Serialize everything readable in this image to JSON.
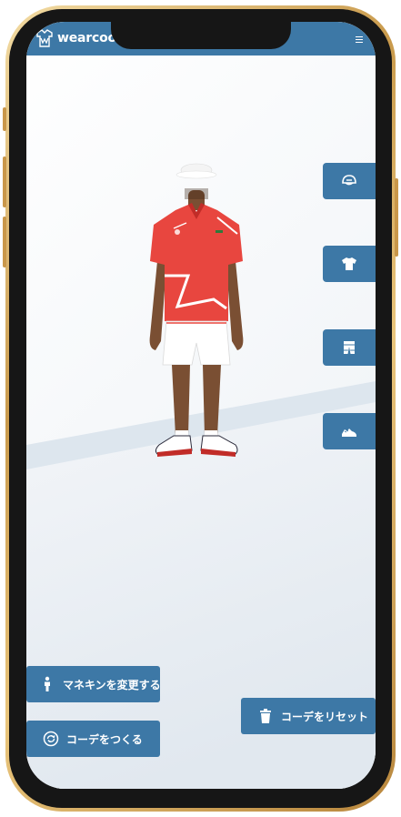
{
  "app": {
    "logo_text": "wearcoord"
  },
  "side_tabs": [
    {
      "id": "head",
      "icon": "cap-icon"
    },
    {
      "id": "tops",
      "icon": "tshirt-icon"
    },
    {
      "id": "bottoms",
      "icon": "shorts-icon"
    },
    {
      "id": "shoes",
      "icon": "sneakers-icon"
    }
  ],
  "buttons": {
    "change_mannequin": "マネキンを変更する",
    "make_coord": "コーデをつくる",
    "reset_coord": "コーデをリセット"
  },
  "colors": {
    "brand": "#3d78a6",
    "shirt": "#e8463f",
    "shorts": "#ffffff",
    "phone_frame": "#c99a4c"
  }
}
